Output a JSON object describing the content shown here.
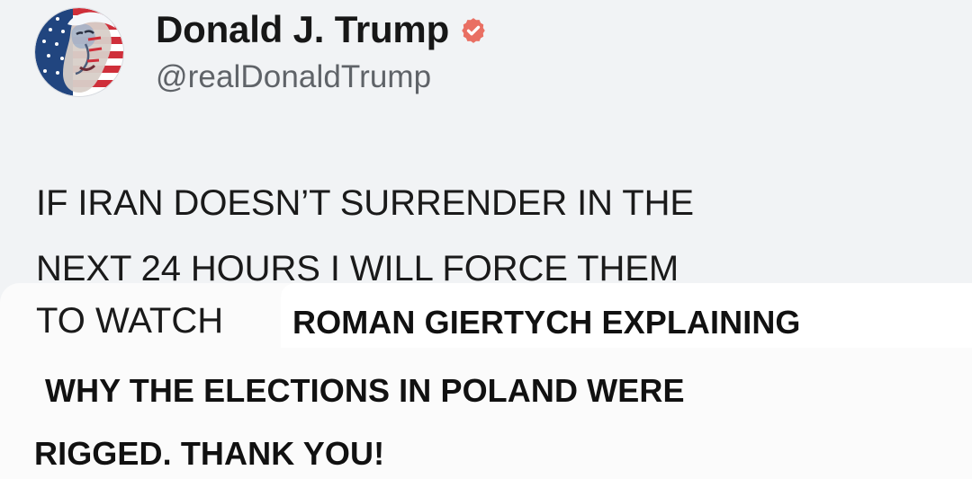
{
  "post": {
    "author": {
      "name": "Donald J. Trump",
      "handle": "@realDonaldTrump",
      "avatar_icon": "flag-portrait-avatar",
      "verified_icon": "verified-badge-icon",
      "verified_color": "#e96f63"
    },
    "body_lines": [
      "IF IRAN DOESN’T SURRENDER IN THE",
      "NEXT 24 HOURS I WILL FORCE THEM",
      "TO WATCH"
    ],
    "overlay_lines": [
      "ROMAN GIERTYCH EXPLAINING",
      "WHY THE ELECTIONS IN POLAND WERE",
      "RIGGED. THANK YOU!"
    ]
  }
}
